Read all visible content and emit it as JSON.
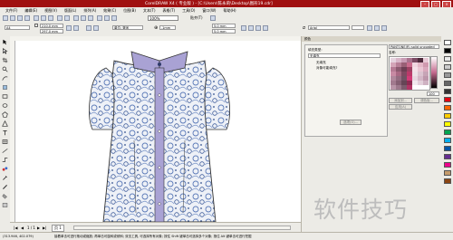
{
  "window": {
    "title": "CorelDRAW X4 ( 专业版 ) - [C:\\Users\\陈永莉\\Desktop\\图形19.cdr]"
  },
  "menu": {
    "items": [
      "文件(F)",
      "编辑(E)",
      "视图(V)",
      "版面(L)",
      "排列(A)",
      "效果(C)",
      "位图(B)",
      "文本(T)",
      "表格(T)",
      "工具(O)",
      "窗口(W)",
      "帮助(H)"
    ]
  },
  "toolbar": {
    "zoom": "100%",
    "align_label": "贴齐(T)"
  },
  "propbar": {
    "paper": "A4",
    "width": "210.0 mm",
    "height": "297.0 mm",
    "units": "单位: 毫米",
    "nudge": ".1mm",
    "dup_x": "5.0 mm",
    "dup_y": "5.0 mm",
    "font": "Arial"
  },
  "docker": {
    "tab": "颜色",
    "fill_type_label": "填充类型:",
    "fill_type_value": "无填充",
    "no_fill_title": "无填充",
    "no_fill_desc": "对象可能填充?",
    "color_model": "PANTONE(R) solid uncoated",
    "name_label": "名称:",
    "add_button": "添加到...",
    "palette_button": "调色板...",
    "apply_button": "应用(A)",
    "options_button": "选项(O)...",
    "amount": "100"
  },
  "pagebar": {
    "page_counter": "1 / 1",
    "page_tab": "页 1"
  },
  "status": {
    "coords": "(313.946, 402.079)",
    "hint": "接着单击可进行拖动或缩放; 再单击可旋转或倾斜; 双击工具, 可选择所有对象; 按住 Shift 键单击可选择多个对象; 按住 Alt 键单击可进行挖掘"
  },
  "watermark": "软件技巧",
  "palette_colors": [
    "#ffffff",
    "#000000",
    "#e9e9e9",
    "#cccccc",
    "#999999",
    "#666666",
    "#333333",
    "#e30613",
    "#ff6600",
    "#ffcc00",
    "#ffff00",
    "#00a651",
    "#00aeef",
    "#0054a6",
    "#662d91",
    "#ec008c",
    "#c69c6d",
    "#8b4513"
  ],
  "swatch_grid": [
    "#e5d2de",
    "#d8b5c8",
    "#c79ab3",
    "#a8728d",
    "#7b4a63",
    "#4d2b3c",
    "#e8c9d6",
    "#d4a5b8",
    "#b77f97",
    "#996076",
    "#c96b8d",
    "#f0d6e0",
    "#e4b8c8",
    "#d09aaf",
    "#b57a94",
    "#8c5a70",
    "#6d3f54",
    "#9e4163",
    "#f5e0e8",
    "#eac7d4",
    "#daa9bd",
    "#c88aa4",
    "#a96884",
    "#7e4a62",
    "#ba3a6a",
    "#ede1e7",
    "#dcc3d0",
    "#c7a4b6",
    "#b0879c",
    "#946b81",
    "#715163",
    "#d23a77",
    "#e7d6df",
    "#d4b7c7",
    "#bd97ab",
    "#a27a8f",
    "#855f73",
    "#654556",
    "#8e2b52",
    "#f2e9ee",
    "#e3d0da",
    "#cfb2c2",
    "#b995a8",
    "#9d788c",
    "#7c5b6d",
    "#b23465"
  ]
}
